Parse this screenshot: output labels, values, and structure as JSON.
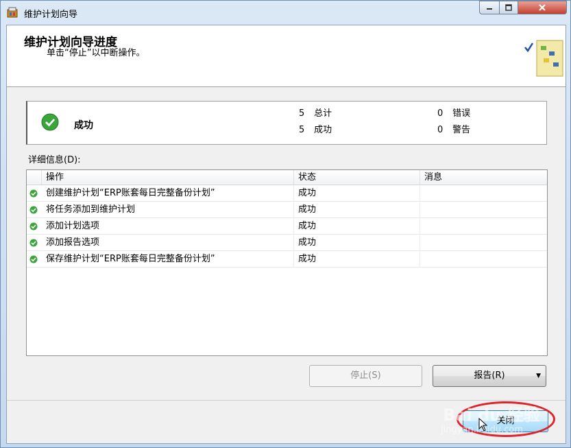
{
  "window": {
    "title": "维护计划向导",
    "controls": {
      "minimize": "minimize-icon",
      "maximize": "maximize-icon",
      "close": "close-icon"
    }
  },
  "header": {
    "title": "维护计划向导进度",
    "subtitle": "单击“停止”以中断操作。"
  },
  "summary": {
    "status": "成功",
    "total_count": "5",
    "total_label": "总计",
    "success_count": "5",
    "success_label": "成功",
    "error_count": "0",
    "error_label": "错误",
    "warning_count": "0",
    "warning_label": "警告"
  },
  "details_label": "详细信息(D):",
  "table": {
    "columns": [
      "操作",
      "状态",
      "消息"
    ],
    "rows": [
      {
        "action": "创建维护计划“ERP账套每日完整备份计划”",
        "status": "成功",
        "message": ""
      },
      {
        "action": "将任务添加到维护计划",
        "status": "成功",
        "message": ""
      },
      {
        "action": "添加计划选项",
        "status": "成功",
        "message": ""
      },
      {
        "action": "添加报告选项",
        "status": "成功",
        "message": ""
      },
      {
        "action": "保存维护计划“ERP账套每日完整备份计划”",
        "status": "成功",
        "message": ""
      }
    ]
  },
  "buttons": {
    "stop": "停止(S)",
    "report": "报告(R)",
    "close": "关闭"
  },
  "watermark": {
    "brand": "Bai du 经验",
    "url": "jingyan.baidu.com"
  },
  "colors": {
    "success_green": "#3aa53a",
    "annotation_red": "#e0232a",
    "close_button_blue": "#3c7fb1"
  }
}
